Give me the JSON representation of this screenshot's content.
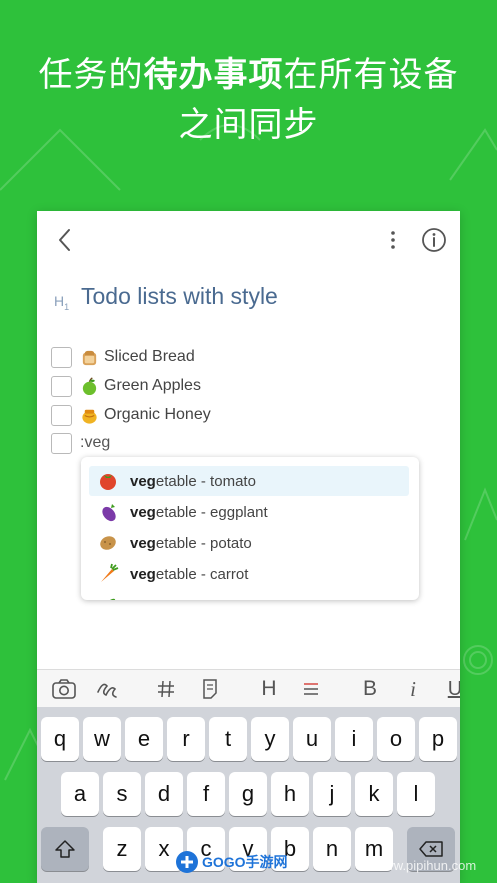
{
  "promo": {
    "headline_1a": "任务的",
    "headline_1b": "待办事项",
    "headline_1c": "在所有设备",
    "headline_2": "之间同步"
  },
  "note": {
    "heading_marker": "H",
    "heading_marker_sub": "1",
    "title": "Todo lists with style",
    "todos": [
      {
        "icon": "bread-icon",
        "label": "Sliced Bread",
        "checked": false
      },
      {
        "icon": "green-apple-icon",
        "label": "Green Apples",
        "checked": false
      },
      {
        "icon": "honey-pot-icon",
        "label": "Organic Honey",
        "checked": false
      }
    ],
    "typing": ":veg"
  },
  "autocomplete": {
    "match_prefix": "veg",
    "items": [
      {
        "icon": "tomato-icon",
        "rest": "etable - tomato",
        "selected": true
      },
      {
        "icon": "eggplant-icon",
        "rest": "etable - eggplant",
        "selected": false
      },
      {
        "icon": "potato-icon",
        "rest": "etable - potato",
        "selected": false
      },
      {
        "icon": "carrot-icon",
        "rest": "etable - carrot",
        "selected": false
      }
    ]
  },
  "toolbar": {
    "heading_label": "H",
    "bold_label": "B",
    "italic_label": "i",
    "underline_label": "U"
  },
  "keyboard": {
    "row1": [
      "q",
      "w",
      "e",
      "r",
      "t",
      "y",
      "u",
      "i",
      "o",
      "p"
    ],
    "row2": [
      "a",
      "s",
      "d",
      "f",
      "g",
      "h",
      "j",
      "k",
      "l"
    ],
    "row3": [
      "z",
      "x",
      "c",
      "v",
      "b",
      "n",
      "m"
    ]
  },
  "watermark": {
    "brand": "GOGO手游网",
    "url": "www.pipihun.com"
  },
  "colors": {
    "background": "#2ec13b",
    "title": "#4a6a90",
    "selection": "#e9f5fb"
  }
}
